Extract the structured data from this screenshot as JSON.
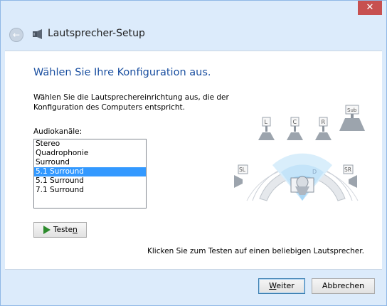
{
  "window": {
    "close_label": "✕",
    "title": "Lautsprecher-Setup"
  },
  "main": {
    "heading": "Wählen Sie Ihre Konfiguration aus.",
    "description": "Wählen Sie die Lautsprechereinrichtung aus, die der Konfiguration des Computers entspricht.",
    "channels_label": "Audiokanäle:",
    "channels": [
      {
        "label": "Stereo",
        "selected": false
      },
      {
        "label": "Quadrophonie",
        "selected": false
      },
      {
        "label": "Surround",
        "selected": false
      },
      {
        "label": "5.1 Surround",
        "selected": true
      },
      {
        "label": "5.1 Surround",
        "selected": false
      },
      {
        "label": "7.1 Surround",
        "selected": false
      }
    ],
    "test_button": {
      "pre": "Teste",
      "mnemonic": "n",
      "post": ""
    },
    "hint": "Klicken Sie zum Testen auf einen beliebigen Lautsprecher."
  },
  "speakers": {
    "front_left": "L",
    "center": "C",
    "front_right": "R",
    "subwoofer": "Sub",
    "surround_left": "SL",
    "surround_right": "SR"
  },
  "footer": {
    "next_button": {
      "pre": "",
      "mnemonic": "W",
      "post": "eiter"
    },
    "cancel_button": "Abbrechen"
  },
  "colors": {
    "accent": "#1a4fa0",
    "selection": "#3399ff",
    "close": "#c75050",
    "chrome": "#dcebfb"
  }
}
